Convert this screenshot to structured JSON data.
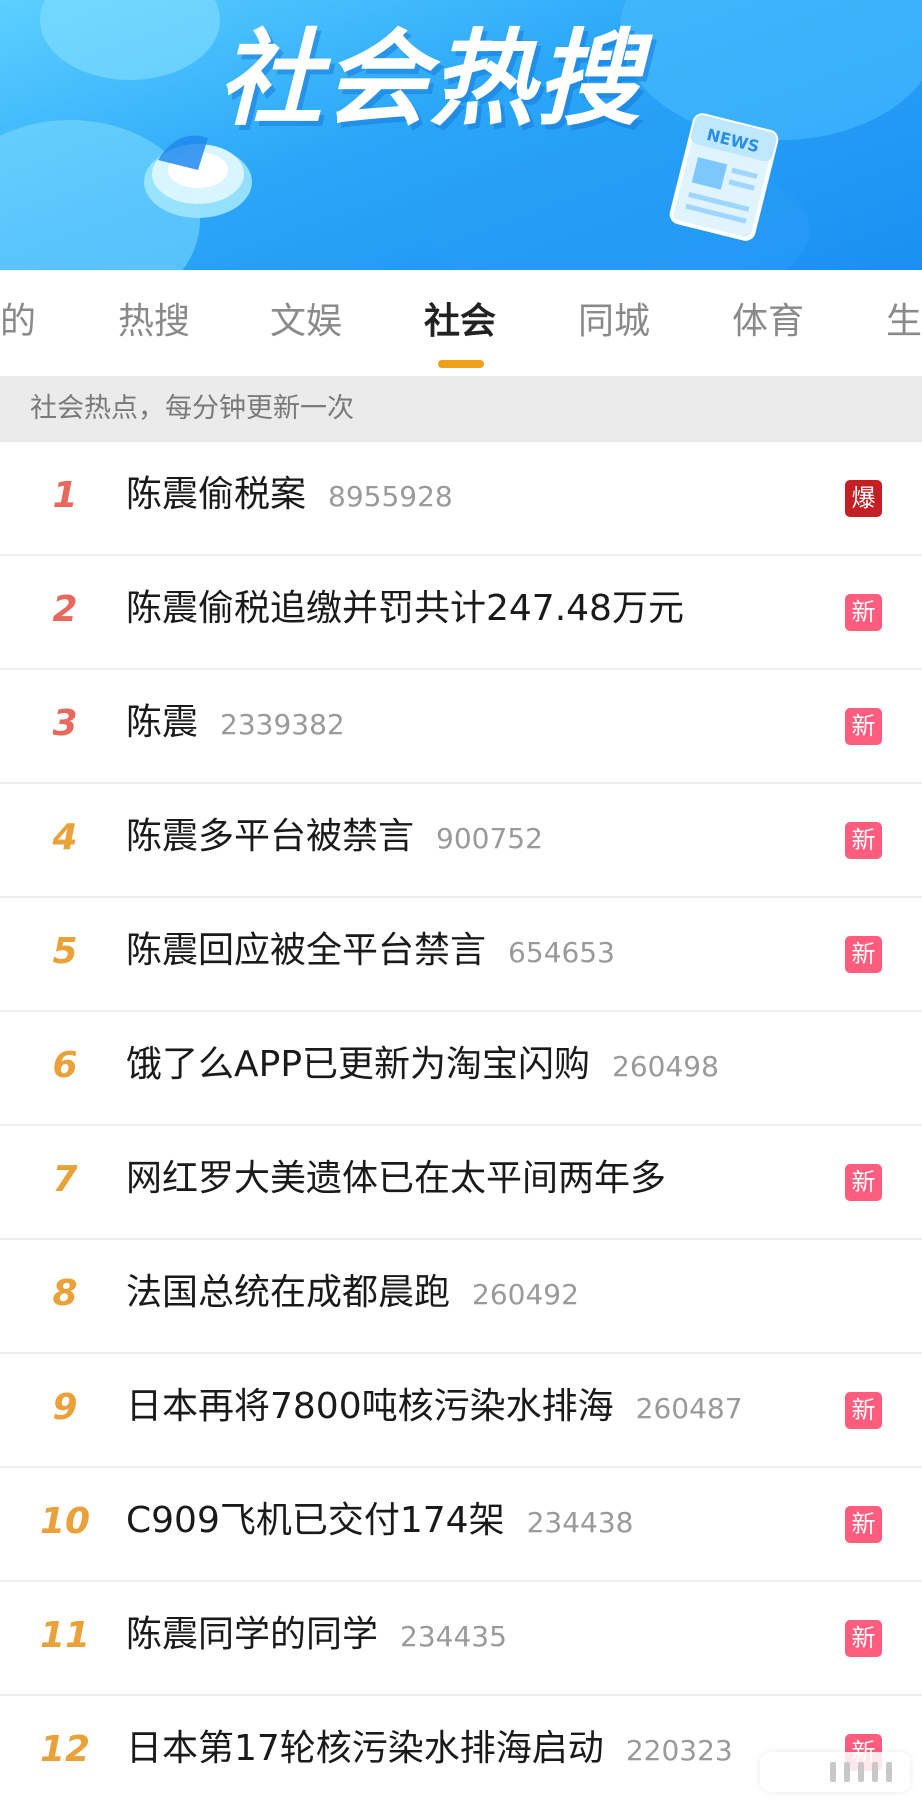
{
  "banner": {
    "title": "社会热搜",
    "news_label": "NEWS",
    "colors": {
      "top": "#5cd0ff",
      "bottom": "#1b8ff2"
    }
  },
  "tabs": [
    {
      "label": "的",
      "active": false
    },
    {
      "label": "热搜",
      "active": false
    },
    {
      "label": "文娱",
      "active": false
    },
    {
      "label": "社会",
      "active": true
    },
    {
      "label": "同城",
      "active": false
    },
    {
      "label": "体育",
      "active": false
    },
    {
      "label": "生",
      "active": false
    }
  ],
  "notice": "社会热点，每分钟更新一次",
  "colors": {
    "accent": "#f0a018",
    "rank_top": "#e8685e",
    "rank_other": "#eba13a",
    "badge_new": "#ff5c7e",
    "badge_hot": "#c41f24"
  },
  "items": [
    {
      "rank": "1",
      "title": "陈震偷税案",
      "count": "8955928",
      "badge": "爆",
      "badge_type": "hot"
    },
    {
      "rank": "2",
      "title": "陈震偷税追缴并罚共计247.48万元",
      "count": "",
      "badge": "新",
      "badge_type": "new"
    },
    {
      "rank": "3",
      "title": "陈震",
      "count": "2339382",
      "badge": "新",
      "badge_type": "new"
    },
    {
      "rank": "4",
      "title": "陈震多平台被禁言",
      "count": "900752",
      "badge": "新",
      "badge_type": "new"
    },
    {
      "rank": "5",
      "title": "陈震回应被全平台禁言",
      "count": "654653",
      "badge": "新",
      "badge_type": "new"
    },
    {
      "rank": "6",
      "title": "饿了么APP已更新为淘宝闪购",
      "count": "260498",
      "badge": "",
      "badge_type": ""
    },
    {
      "rank": "7",
      "title": "网红罗大美遗体已在太平间两年多",
      "count": "",
      "badge": "新",
      "badge_type": "new"
    },
    {
      "rank": "8",
      "title": "法国总统在成都晨跑",
      "count": "260492",
      "badge": "",
      "badge_type": ""
    },
    {
      "rank": "9",
      "title": "日本再将7800吨核污染水排海",
      "count": "260487",
      "badge": "新",
      "badge_type": "new"
    },
    {
      "rank": "10",
      "title": "C909飞机已交付174架",
      "count": "234438",
      "badge": "新",
      "badge_type": "new"
    },
    {
      "rank": "11",
      "title": "陈震同学的同学",
      "count": "234435",
      "badge": "新",
      "badge_type": "new"
    },
    {
      "rank": "12",
      "title": "日本第17轮核污染水排海启动",
      "count": "220323",
      "badge": "新",
      "badge_type": "new"
    }
  ]
}
